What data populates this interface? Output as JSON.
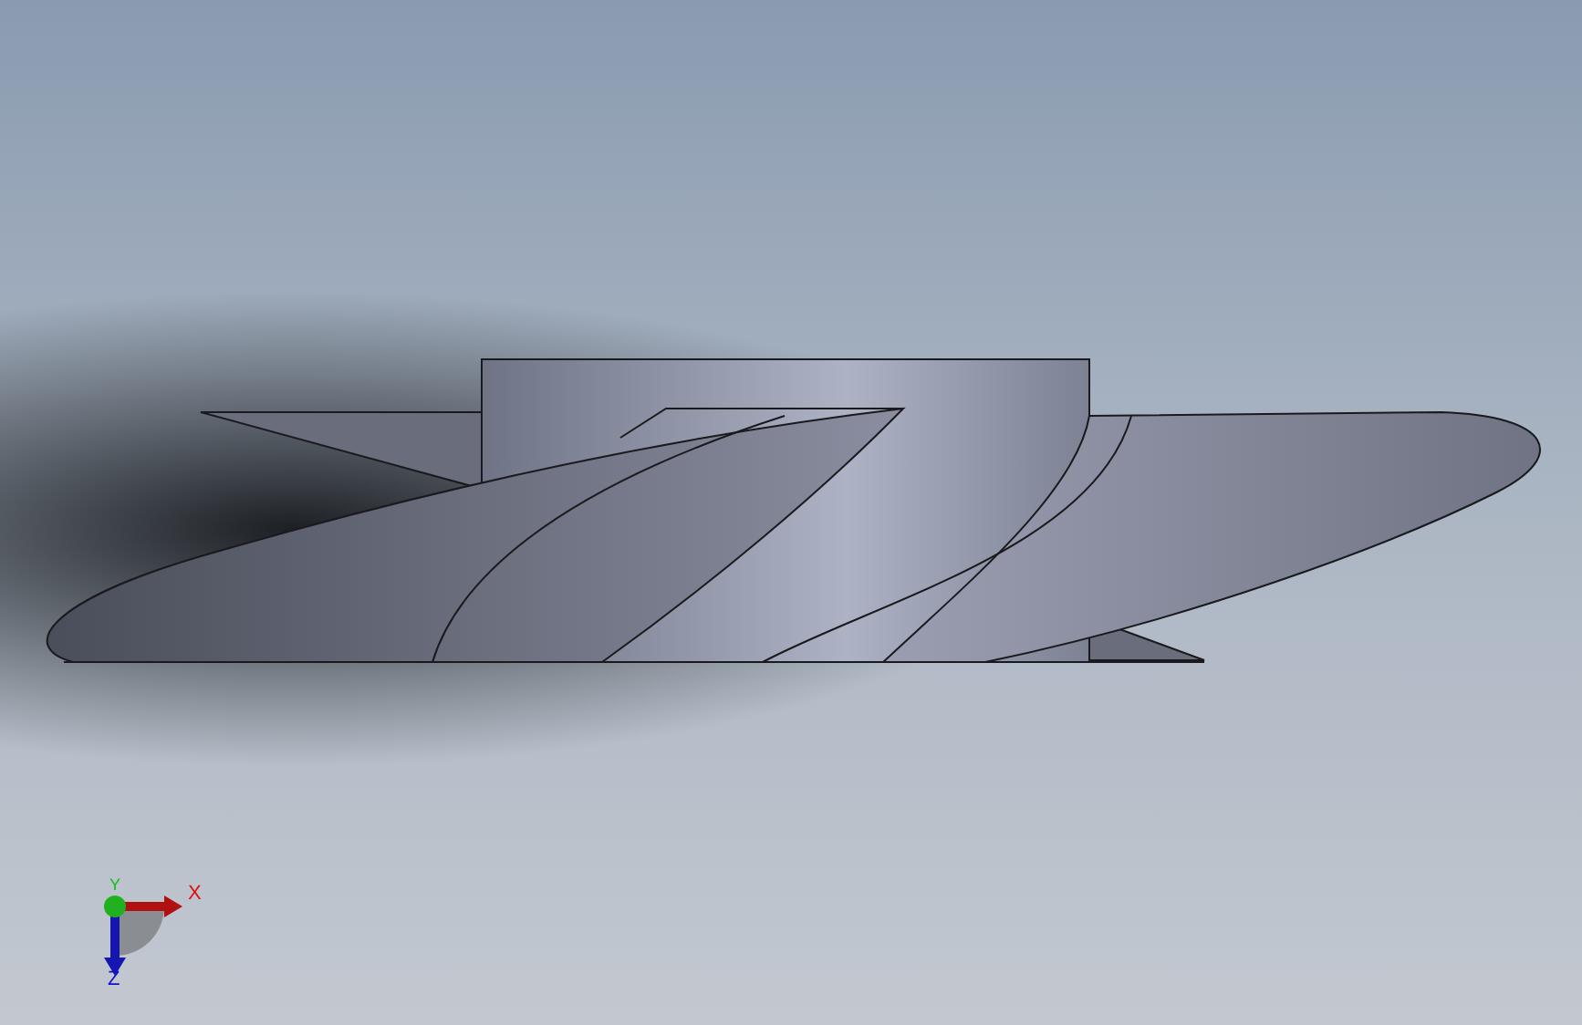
{
  "triad": {
    "axes": [
      {
        "label": "X",
        "color": "#e01010"
      },
      {
        "label": "Y",
        "color": "#10c010"
      },
      {
        "label": "Z",
        "color": "#1010d0"
      }
    ]
  }
}
